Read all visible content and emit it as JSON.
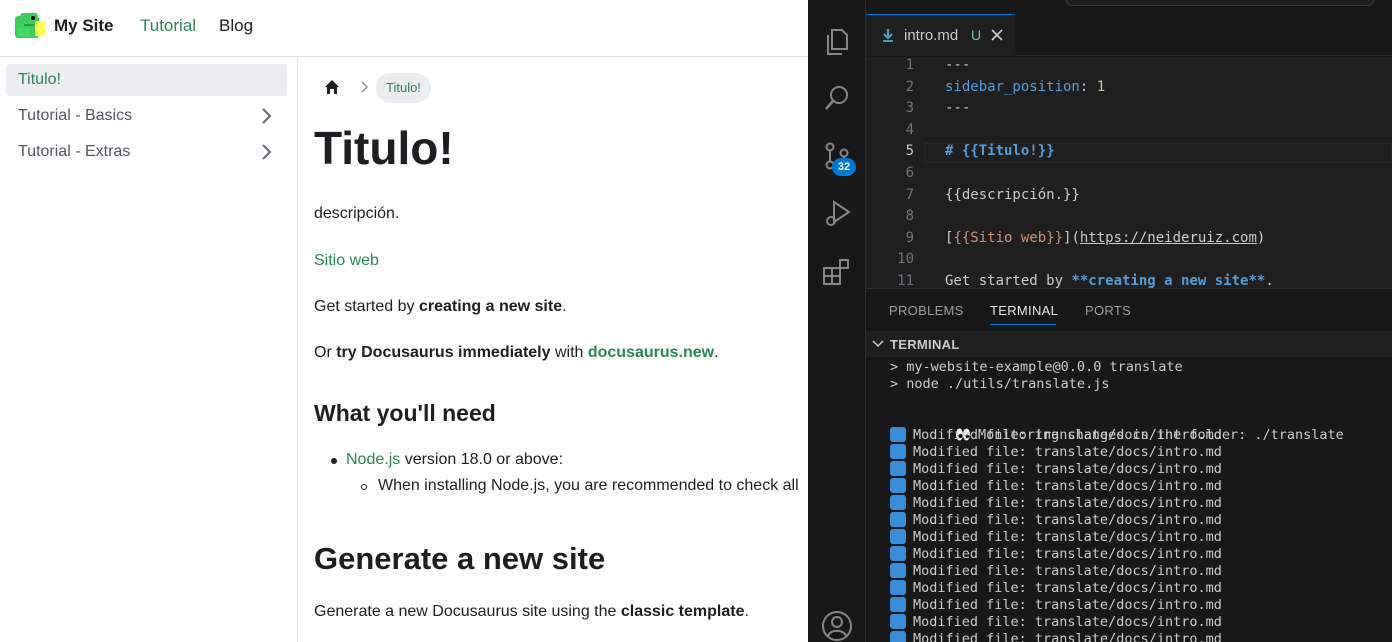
{
  "site": {
    "brand": "My Site",
    "nav": {
      "tutorial": "Tutorial",
      "blog": "Blog"
    },
    "sidebar": [
      {
        "label": "Titulo!",
        "active": true
      },
      {
        "label": "Tutorial - Basics",
        "active": false
      },
      {
        "label": "Tutorial - Extras",
        "active": false
      }
    ],
    "breadcrumb": {
      "current": "Titulo!"
    },
    "doc": {
      "title": "Titulo!",
      "description": "descripción.",
      "website_link": "Sitio web",
      "p1_pre": "Get started by ",
      "p1_bold": "creating a new site",
      "p1_post": ".",
      "p2_pre": "Or ",
      "p2_bold": "try Docusaurus immediately",
      "p2_mid": " with ",
      "p2_link": "docusaurus.new",
      "p2_post": ".",
      "h_need": "What you'll need",
      "li1_link": "Node.js",
      "li1_text": " version 18.0 or above:",
      "li2_text": "When installing Node.js, you are recommended to check all",
      "h_generate": "Generate a new site",
      "p3_pre": "Generate a new Docusaurus site using the ",
      "p3_bold": "classic template",
      "p3_post": "."
    }
  },
  "vscode": {
    "scm_badge": "32",
    "tab": {
      "name": "intro.md",
      "status": "U"
    },
    "lines": [
      {
        "n": "1",
        "parts": [
          {
            "t": "---",
            "c": "#cccccc"
          }
        ]
      },
      {
        "n": "2",
        "parts": [
          {
            "t": "sidebar_position",
            "c": "#569cd6"
          },
          {
            "t": ": ",
            "c": "#cccccc"
          },
          {
            "t": "1",
            "c": "#b5cea8"
          }
        ]
      },
      {
        "n": "3",
        "parts": [
          {
            "t": "---",
            "c": "#cccccc"
          }
        ]
      },
      {
        "n": "4",
        "parts": []
      },
      {
        "n": "5",
        "parts": [
          {
            "t": "# {{Titulo!}}",
            "c": "#569cd6",
            "b": true
          }
        ]
      },
      {
        "n": "6",
        "parts": []
      },
      {
        "n": "7",
        "parts": [
          {
            "t": "{{descripción.}}",
            "c": "#cccccc"
          }
        ]
      },
      {
        "n": "8",
        "parts": []
      },
      {
        "n": "9",
        "parts": [
          {
            "t": "[",
            "c": "#cccccc"
          },
          {
            "t": "{{Sitio web}}",
            "c": "#ce9178"
          },
          {
            "t": "](",
            "c": "#cccccc"
          },
          {
            "t": "https://neideruiz.com",
            "c": "#cccccc",
            "u": true
          },
          {
            "t": ")",
            "c": "#cccccc"
          }
        ]
      },
      {
        "n": "10",
        "parts": []
      },
      {
        "n": "11",
        "parts": [
          {
            "t": "Get started by ",
            "c": "#cccccc"
          },
          {
            "t": "**creating a new site**",
            "c": "#569cd6",
            "b": true
          },
          {
            "t": ".",
            "c": "#cccccc"
          }
        ]
      }
    ],
    "current_line": "5",
    "panel_tabs": {
      "problems": "PROBLEMS",
      "terminal": "TERMINAL",
      "ports": "PORTS"
    },
    "terminal_title": "TERMINAL",
    "terminal": {
      "cmd1": "> my-website-example@0.0.0 translate",
      "cmd2": "> node ./utils/translate.js",
      "monitor": "Monitoring changes in the folder: ./translate",
      "modified": [
        "Modified file: translate/docs/intro.md",
        "Modified file: translate/docs/intro.md",
        "Modified file: translate/docs/intro.md",
        "Modified file: translate/docs/intro.md",
        "Modified file: translate/docs/intro.md",
        "Modified file: translate/docs/intro.md",
        "Modified file: translate/docs/intro.md",
        "Modified file: translate/docs/intro.md",
        "Modified file: translate/docs/intro.md",
        "Modified file: translate/docs/intro.md",
        "Modified file: translate/docs/intro.md",
        "Modified file: translate/docs/intro.md",
        "Modified file: translate/docs/intro.md"
      ]
    }
  },
  "colors": {
    "accent_green": "#2e8555",
    "vscode_blue": "#0078d4"
  }
}
